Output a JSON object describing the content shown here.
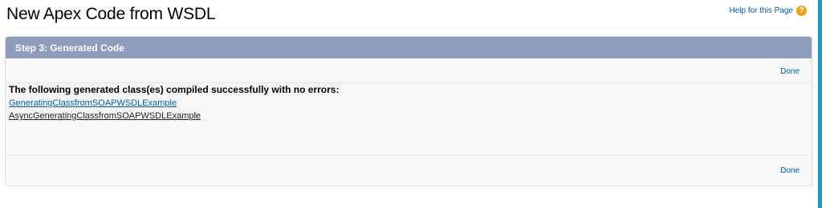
{
  "page": {
    "title": "New Apex Code from WSDL",
    "help_link": "Help for this Page",
    "help_icon_glyph": "?",
    "help_icon": "help-icon",
    "accent_color": "#1798c1"
  },
  "panel": {
    "header": "Step 3: Generated Code",
    "top_done_label": "Done",
    "message": "The following generated class(es) compiled successfully with no errors:",
    "classes": [
      "GeneratingClassfromSOAPWSDLExample",
      "AsyncGeneratingClassfromSOAPWSDLExample"
    ],
    "bottom_done_label": "Done",
    "header_color": "#8e9dbe"
  }
}
